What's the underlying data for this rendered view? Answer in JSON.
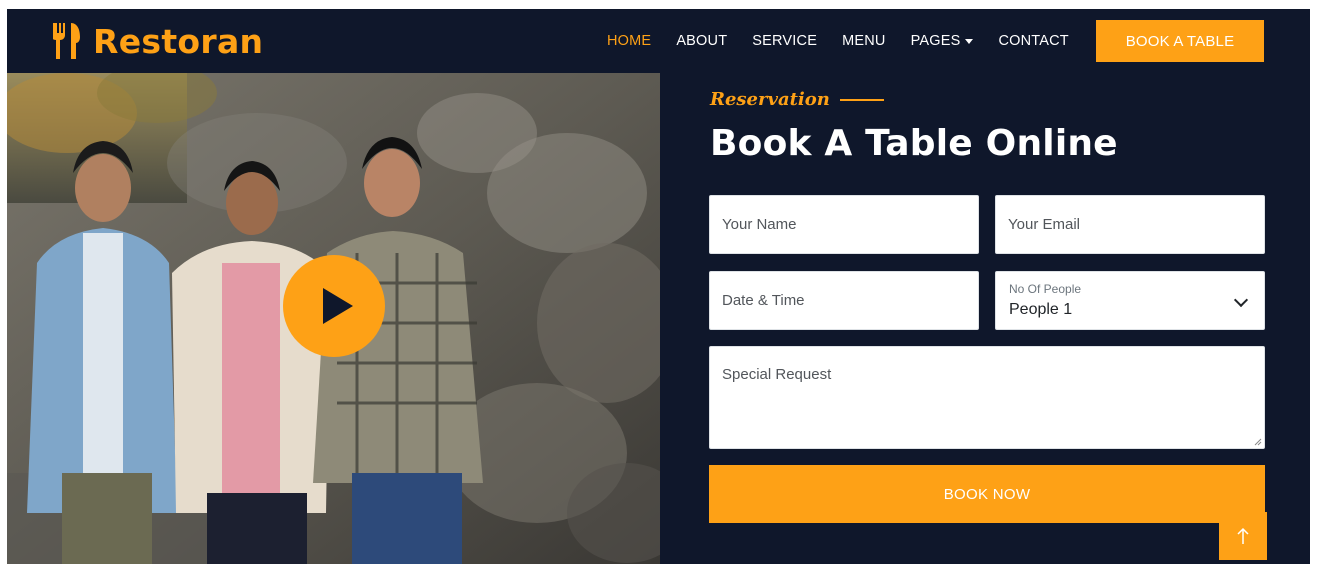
{
  "brand": {
    "name": "Restoran",
    "icon": "utensils-icon",
    "color": "#fea116"
  },
  "nav": {
    "items": [
      {
        "label": "HOME",
        "active": true
      },
      {
        "label": "ABOUT"
      },
      {
        "label": "SERVICE"
      },
      {
        "label": "MENU"
      },
      {
        "label": "PAGES",
        "dropdown": true
      },
      {
        "label": "CONTACT"
      }
    ],
    "cta": "BOOK A TABLE"
  },
  "video": {
    "play_icon": "play-icon"
  },
  "reservation": {
    "subtitle": "Reservation",
    "title": "Book A Table Online",
    "fields": {
      "name_placeholder": "Your Name",
      "email_placeholder": "Your Email",
      "datetime_placeholder": "Date & Time",
      "people_label": "No Of People",
      "people_value": "People 1",
      "request_placeholder": "Special Request"
    },
    "submit": "BOOK NOW"
  },
  "back_to_top_icon": "arrow-up-icon",
  "colors": {
    "primary": "#fea116",
    "dark": "#0f172b",
    "white": "#ffffff"
  }
}
